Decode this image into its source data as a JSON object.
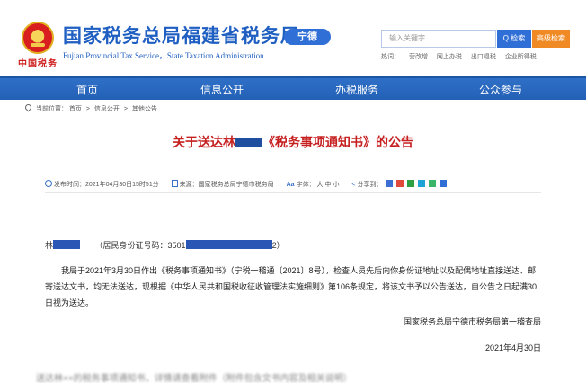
{
  "header": {
    "emblem_text": "中国税务",
    "title": "国家税务总局福建省税务局",
    "subtitle": "Fujian Provincial Tax Service，State Taxation Administration",
    "city_badge": "宁德"
  },
  "search": {
    "placeholder": "输入关键字",
    "button_label": "Q 检索",
    "advanced_label": "高级检索"
  },
  "hot_links": {
    "label": "热词：",
    "items": [
      "营改增",
      "网上办税",
      "出口退税",
      "企业所得税"
    ]
  },
  "nav": {
    "items": [
      "首页",
      "信息公开",
      "办税服务",
      "公众参与"
    ]
  },
  "breadcrumb": {
    "label": "当前位置：",
    "items": [
      "首页",
      "信息公开",
      "其他公告"
    ],
    "sep": ">"
  },
  "article": {
    "title_prefix": "关于送达林",
    "title_suffix": "《税务事项通知书》的公告",
    "meta": {
      "published": "发布时间：2021年04月30日15时51分",
      "source": "来源：国家税务总局宁德市税务局",
      "font": "字体：",
      "font_sizes": [
        "大",
        "中",
        "小"
      ],
      "share": "分享到："
    },
    "recipient_prefix": "林",
    "recipient_id_label": "（居民身份证号码：3501",
    "recipient_id_suffix": "2）",
    "body": "我局于2021年3月30日作出《税务事项通知书》（宁税一稽通〔2021〕8号），检查人员先后向你身份证地址以及配偶地址直接送达、邮寄送达文书，均无法送达，现根据《中华人民共和国税收征收管理法实施细则》第106条规定，将该文书予以公告送达，自公告之日起满30日视为送达。",
    "signature": "国家税务总局宁德市税务局第一稽查局",
    "date": "2021年4月30日",
    "blurred_text": "送达林××的税务事项通知书，详情请查看附件（附件包含文书内容及相关说明）"
  },
  "colors": {
    "brand_blue": "#1f5fc2",
    "nav_blue": "#2f6fc7",
    "title_red": "#c61f1f",
    "adv_orange": "#f08a24",
    "redact_blue": "#2a56b5"
  },
  "icons": {
    "emblem": "tax-emblem-icon",
    "search": "search-icon",
    "pin": "location-pin-icon",
    "clock": "clock-icon",
    "source": "document-icon",
    "font": "font-size-icon",
    "share": "share-icon"
  }
}
